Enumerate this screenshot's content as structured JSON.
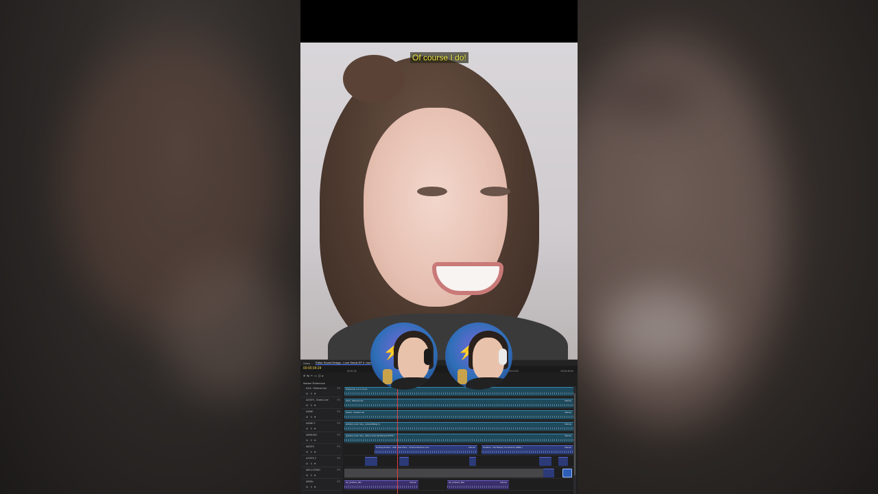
{
  "caption": "Of course I do!",
  "editor": {
    "tabs": [
      "Video",
      "Editor Sound Design - Love Seeds EP 4 .mov"
    ],
    "timecode": "00:00:34:24",
    "ruler": [
      "00:01:24",
      "00:02:00",
      "00:02:45:00",
      "00:03:10:00",
      "00:03:45:00"
    ],
    "tools": [
      "⊕",
      "↹",
      "✂",
      "▭",
      "◫",
      "▸"
    ],
    "markers_label": "Marker Reference",
    "tracks": [
      {
        "name": "A1/A - Sheena Line",
        "ctrls": "M S ⏺",
        "ms": "FX"
      },
      {
        "name": "A2/SFX - Sneha Line",
        "ctrls": "M S ⏺",
        "ms": "FX"
      },
      {
        "name": "A3/ME",
        "ctrls": "M S ⏺",
        "ms": "FX"
      },
      {
        "name": "A4/ME 2",
        "ctrls": "M S ⏺",
        "ms": "FX"
      },
      {
        "name": "A5/MUSIC",
        "ctrls": "M S ⏺",
        "ms": "FX"
      },
      {
        "name": "A6/SFX",
        "ctrls": "M S ⏺",
        "ms": "FX"
      },
      {
        "name": "A7/SFX 2",
        "ctrls": "M S ⏺",
        "ms": "FX"
      },
      {
        "name": "A8/CLOSING",
        "ctrls": "M S ⏺",
        "ms": "FX"
      },
      {
        "name": "A9/Mix",
        "ctrls": "M S ⏺",
        "ms": "FX"
      }
    ],
    "clips": [
      {
        "track": 0,
        "label": "Sneha line 1 & 2 (.mov)",
        "right": "",
        "color": "teal"
      },
      {
        "track": 1,
        "label": "A1/A - Sheena Line",
        "right": "Volume",
        "color": "teal"
      },
      {
        "track": 2,
        "label": "Sneha - Gussie Line",
        "right": "Volume",
        "color": "teal"
      },
      {
        "track": 3,
        "label": "ambient_room tone_ (scene/dialog 1)",
        "right": "Volume",
        "color": "teal"
      },
      {
        "track": 4,
        "label": "ambient_room tone_ (Room tone (ambiance) ANTM )",
        "right": "Volume",
        "color": "teal"
      },
      {
        "track": 5,
        "label": "Hunting Dreams - Alan Beat Piano - Cinema Reverse Intro",
        "right": "Volume",
        "color": "navy"
      },
      {
        "track": 5,
        "label": "Gurkhas - The Beauty of Innocence (#BIG )",
        "right": "Volume",
        "color": "navy"
      },
      {
        "track": 8,
        "label": "sfx_ambient_001",
        "right": "Volume",
        "color": "purple"
      },
      {
        "track": 8,
        "label": "sfx_ambient_002",
        "right": "Volume",
        "color": "purple"
      }
    ]
  },
  "cams": [
    {
      "icon": "streamer-icon"
    },
    {
      "icon": "streamer-icon"
    }
  ]
}
